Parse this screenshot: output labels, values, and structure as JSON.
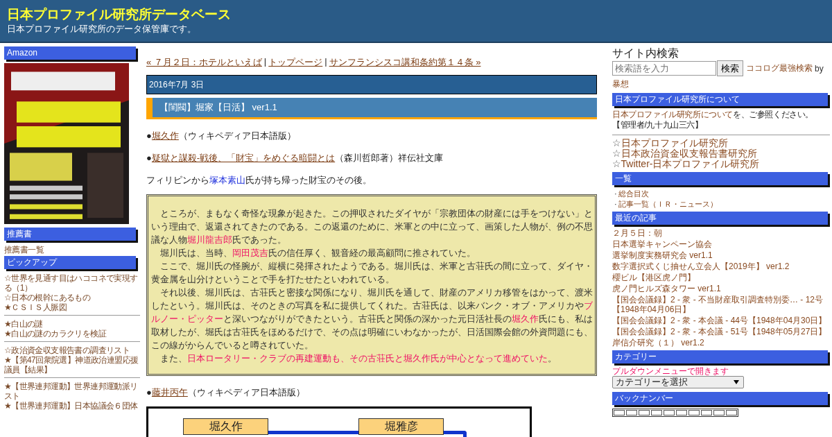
{
  "header": {
    "title": "日本プロファイル研究所データベース",
    "subtitle": "日本プロファイル研究所のデータ保管庫です。"
  },
  "left_sidebar": {
    "sections": [
      {
        "heading": "Amazon",
        "kind": "picture"
      },
      {
        "heading": "推薦書",
        "kind": "links",
        "groups": [
          [
            "推薦書一覧"
          ]
        ]
      },
      {
        "heading": "ピックアップ",
        "kind": "links",
        "groups": [
          [
            "☆世界を見通す目はハココネで実現する（1）",
            "☆日本の根幹にあるもの",
            "★ＣＳＩＳ人脈図"
          ],
          [
            "★白山の謎",
            "★白山の謎のカラクリを検証"
          ],
          [
            "☆政治資金収支報告書の調査リスト",
            "★【第47回衆院選】神道政治連盟応援議員【結果】"
          ],
          [
            "★【世界連邦運動】世界連邦運動派リスト",
            "★【世界連邦運動】日本協議会６団体"
          ]
        ]
      }
    ]
  },
  "post": {
    "nav": [
      {
        "label": "« ７月２日：ホテルといえば"
      },
      {
        "label": "トップページ"
      },
      {
        "label": "サンフランシスコ講和条約第１４条 »"
      }
    ],
    "nav_separator": "|",
    "date": "2016年7月 3日",
    "title": "【閨閥】堀家【日活】 ver1.1",
    "lines": [
      [
        {
          "text": "●",
          "kind": "plain"
        },
        {
          "text": "堀久作",
          "kind": "link"
        },
        {
          "text": "（ウィキペディア日本語版）",
          "kind": "plain"
        }
      ],
      [
        {
          "text": "●",
          "kind": "plain"
        },
        {
          "text": "疑獄と謀殺-戦後、「財宝」をめぐる暗闘とは",
          "kind": "link"
        },
        {
          "text": "（森川哲郎著）祥伝社文庫",
          "kind": "plain"
        }
      ],
      [
        {
          "text": "フィリピンから",
          "kind": "plain"
        },
        {
          "text": "塚本素山",
          "kind": "name"
        },
        {
          "text": "氏が持ち帰った財宝のその後。",
          "kind": "plain"
        }
      ]
    ],
    "quote": [
      [
        {
          "text": "　ところが、まもなく奇怪な現象が起きた。この押収されたダイヤが「宗教団体の財産には手をつけない」という理由で、返還されてきたのである。この返還のために、米軍との中に立って、画策した人物が、例の不思議な人物",
          "highlight": false
        },
        {
          "text": "堀川龍吉郎",
          "highlight": true
        },
        {
          "text": "氏であった。",
          "highlight": false
        }
      ],
      [
        {
          "text": "　堀川氏は、当時、",
          "highlight": false
        },
        {
          "text": "岡田茂吉",
          "highlight": true
        },
        {
          "text": "氏の信任厚く、観音経の最高顧問に推されていた。",
          "highlight": false
        }
      ],
      [
        {
          "text": "　ここで、堀川氏の怪腕が、縦横に発揮されたようである。堀川氏は、米軍と古荘氏の間に立って、ダイヤ・黄金属を山分けということで手を打たせたといわれている。",
          "highlight": false
        }
      ],
      [
        {
          "text": "　それ以後、堀川氏は、古荘氏と密接な関係になり、堀川氏を通して、財産のアメリカ移管をはかって、渡米したという。堀川氏は、そのときの写真を私に提供してくれた。古荘氏は、以来バンク・オブ・アメリカや",
          "highlight": false
        },
        {
          "text": "ブルノー・ピッター",
          "highlight": true
        },
        {
          "text": "と深いつながりができたという。古荘氏と関係の深かった元日活社長の",
          "highlight": false
        },
        {
          "text": "堀久作",
          "highlight": true
        },
        {
          "text": "氏にも、私は取材したが、堀氏は古荘氏をほめるだけで、その点は明確にいわなかったが、日活国際会館の外資問題にも、この線がからんでいると噂されていた。",
          "highlight": false
        }
      ],
      [
        {
          "text": "　また、",
          "highlight": false
        },
        {
          "text": "日本ロータリー・クラブの再建運動も、その古荘氏と堀久作氏が中心となって進めていた",
          "highlight": true
        },
        {
          "text": "。",
          "highlight": false
        }
      ]
    ],
    "after": [
      {
        "text": "●",
        "kind": "plain"
      },
      {
        "text": "藤井丙午",
        "kind": "link"
      },
      {
        "text": "（ウィキペディア日本語版）",
        "kind": "plain"
      }
    ],
    "diagram": {
      "nodes": [
        "堀久作",
        "堀雅彦"
      ]
    }
  },
  "right_sidebar": {
    "search": {
      "heading": "サイト内検索",
      "placeholder": "検索語を入力",
      "button": "検索",
      "credit_link": "ココログ最強検索",
      "credit_by": "by",
      "credit_author": "暴想"
    },
    "about": {
      "heading": "日本プロファイル研究所について",
      "link": "日本プロファイル研究所について",
      "text": "を、ご参照ください。",
      "admin": "【管理者/九十九山三六】"
    },
    "sites": [
      {
        "mark": "☆",
        "label": "日本プロファイル研究所"
      },
      {
        "mark": "☆",
        "label": "日本政治資金収支報告書研究所"
      },
      {
        "mark": "☆",
        "label": "Twitter-日本プロファイル研究所"
      }
    ],
    "index": {
      "heading": "一覧",
      "items": [
        {
          "mark": "·",
          "label": "総合目次"
        },
        {
          "mark": "·",
          "label": "記事一覧（ＩＲ・ニュース）"
        }
      ]
    },
    "recent": {
      "heading": "最近の記事",
      "items": [
        "２月５日：朝",
        "日本選挙キャンペーン協会",
        "選挙制度実務研究会 ver1.1",
        "数字選択式くじ抽せん立会人【2019年】 ver1.2",
        "櫻ビル【港区虎ノ門】",
        "虎ノ門ヒルズ森タワー ver1.1",
        "【国会会議録】2 - 衆 - 不当財産取引調査特別委… - 12号【1948年04月06日】",
        "【国会会議録】2 - 衆 - 本会議 - 44号【1948年04月30日】",
        "【国会会議録】2 - 衆 - 本会議 - 51号【1948年05月27日】",
        "岸信介研究（１） ver1.2"
      ]
    },
    "category": {
      "heading": "カテゴリー",
      "hint": "プルダウンメニューで開きます",
      "select": "カテゴリーを選択"
    },
    "backnumber": {
      "heading": "バックナンバー"
    }
  }
}
